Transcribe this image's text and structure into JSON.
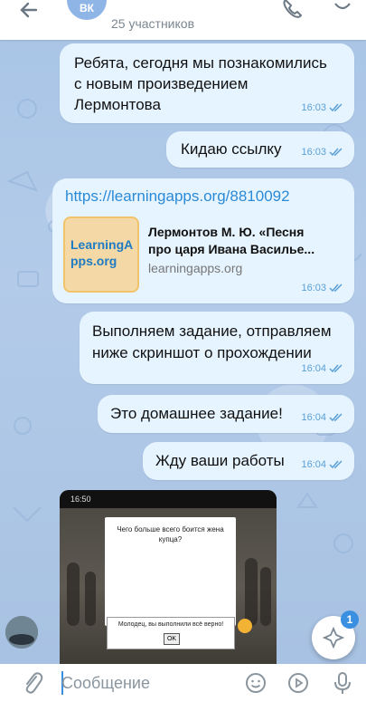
{
  "header": {
    "avatar_initials": "ВК",
    "members": "25 участников"
  },
  "messages": [
    {
      "text": "Ребята, сегодня мы познакомились с новым произведением Лермонтова",
      "time": "16:03"
    },
    {
      "text": "Кидаю ссылку",
      "time": "16:03"
    },
    {
      "url": "https://learningapps.org/8810092",
      "preview_title": "Лермонтов М. Ю. «Песня про царя Ивана Василье...",
      "preview_site": "learningapps.org",
      "preview_logo": "LearningApps.org",
      "time": "16:03"
    },
    {
      "text": "Выполняем задание, отправляем ниже скриншот о прохождении",
      "time": "16:04"
    },
    {
      "text": "Это домашнее задание!",
      "time": "16:04"
    },
    {
      "text": "Жду ваши работы",
      "time": "16:04"
    }
  ],
  "screenshot": {
    "status_time": "16:50",
    "question": "Чего больше всего боится жена купца?",
    "dialog_text": "Молодец, вы выполнили всё верно!",
    "ok_label": "OK"
  },
  "fab": {
    "badge": "1"
  },
  "input": {
    "placeholder": "Сообщение"
  },
  "colors": {
    "bubble": "#e6f4ff",
    "accent": "#3a8fe0",
    "link": "#2b8ad6",
    "time": "#5aa0d6"
  },
  "icons": [
    "back-arrow-icon",
    "phone-icon",
    "more-icon",
    "double-check-icon",
    "attach-icon",
    "emoji-icon",
    "video-message-icon",
    "microphone-icon",
    "sparkle-icon"
  ]
}
